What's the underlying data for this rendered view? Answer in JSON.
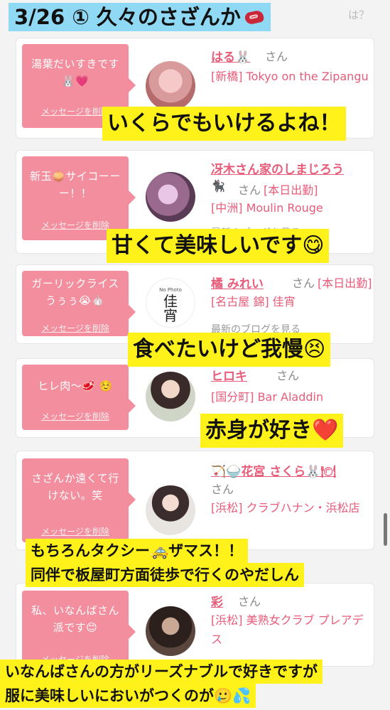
{
  "header": {
    "title": "3/26 ① 久々のさざんか",
    "help_text": "は？"
  },
  "san_label": "さん",
  "delete_label": "メッセージを削除",
  "blog_label": "最新のブログを見る",
  "cards": [
    {
      "message": "湯葉だいすきです🐰💗",
      "name": "はる🐰",
      "status": "",
      "shop": "[新橋] Tokyo on the Zipangu"
    },
    {
      "message": "新玉🧅サイコーーー！！",
      "name": "冴木さん家のしまじろう",
      "name_suffix": "🐈‍⬛",
      "status": "[本日出勤]",
      "shop": "[中洲] Moulin Rouge"
    },
    {
      "message": "ガーリックライス うぅぅ😭🧄",
      "name": "橘 みれい",
      "status": "[本日出勤]",
      "shop": "[名古屋 錦] 佳宵",
      "avatar_text": "No Photo",
      "avatar_logo": "佳宵"
    },
    {
      "message": "ヒレ肉〜🥩 ☺️",
      "name": "ヒロキ",
      "status": "",
      "shop": "[国分町] Bar Aladdin"
    },
    {
      "message": "さざんか遠くて行けない。笑",
      "name": "🏹🍚花宮 さくら🐰🍽",
      "status": "",
      "shop": "[浜松] クラブハナン・浜松店"
    },
    {
      "message": "私、いなんばさん派です😊",
      "name": "彩",
      "status": "",
      "shop": "[浜松] 美熟女クラブ プレアデス"
    }
  ],
  "captions": [
    {
      "text": "いくらでもいけるよね！"
    },
    {
      "text": "甘くて美味しいです",
      "emoji": "😋"
    },
    {
      "text": "食べたいけど我慢",
      "emoji": "😣"
    },
    {
      "text": "赤身が好き",
      "emoji": "❤️"
    },
    {
      "lines": [
        "もちろんタクシー🚕ザマス！！",
        "同伴で板屋町方面徒歩で行くのやだしん"
      ]
    },
    {
      "lines": [
        "いなんばさんの方がリーズナブルで好きですが",
        "服に美味しいにおいがつくのが🥲💦"
      ]
    }
  ],
  "colors": {
    "bubble": "#f28e9e",
    "accent": "#e85c79",
    "caption_bg": "#fff21a",
    "header_bg": "#8fd9f5"
  }
}
